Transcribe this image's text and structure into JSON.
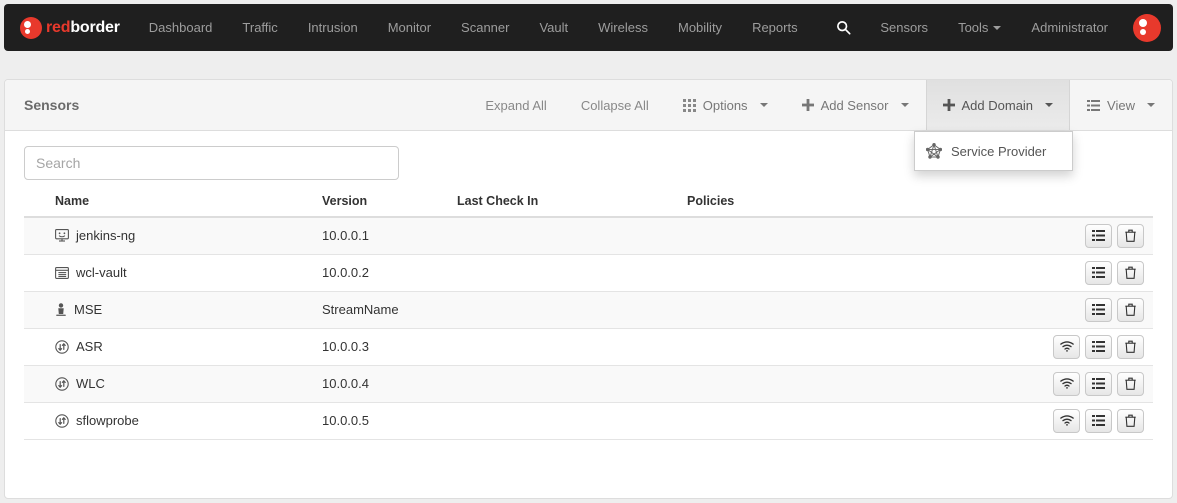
{
  "brand": {
    "part1": "red",
    "part2": "border",
    "logo_icon": "redborder-logo-icon",
    "color": "#e8392c"
  },
  "navbar": {
    "items": [
      {
        "label": "Dashboard"
      },
      {
        "label": "Traffic"
      },
      {
        "label": "Intrusion"
      },
      {
        "label": "Monitor"
      },
      {
        "label": "Scanner"
      },
      {
        "label": "Vault"
      },
      {
        "label": "Wireless"
      },
      {
        "label": "Mobility"
      },
      {
        "label": "Reports"
      }
    ],
    "search_icon": "search-icon",
    "right_items": [
      {
        "label": "Sensors",
        "caret": false
      },
      {
        "label": "Tools",
        "caret": true
      },
      {
        "label": "Administrator",
        "caret": false
      }
    ],
    "avatar_icon": "user-avatar-icon",
    "background": "#1f1f1f"
  },
  "panel": {
    "title": "Sensors",
    "actions": [
      {
        "label": "Expand All",
        "icon": null,
        "caret": false,
        "active": false
      },
      {
        "label": "Collapse All",
        "icon": null,
        "caret": false,
        "active": false
      },
      {
        "label": "Options",
        "icon": "grid-icon",
        "caret": true,
        "active": false
      },
      {
        "label": "Add Sensor",
        "icon": "plus-icon",
        "caret": true,
        "active": false
      },
      {
        "label": "Add Domain",
        "icon": "plus-icon",
        "caret": true,
        "active": true
      },
      {
        "label": "View",
        "icon": "list-icon",
        "caret": true,
        "active": false
      }
    ],
    "dropdown": {
      "open": true,
      "items": [
        {
          "label": "Service Provider",
          "icon": "network-pentagon-icon"
        }
      ]
    }
  },
  "search": {
    "value": "",
    "placeholder": "Search"
  },
  "table": {
    "columns": [
      "Name",
      "Version",
      "Last Check In",
      "Policies"
    ],
    "rows": [
      {
        "icon": "monitor-icon",
        "name": "jenkins-ng",
        "version": "10.0.0.1",
        "last_check_in": "",
        "policies": "",
        "actions": [
          "list-icon",
          "trash-icon"
        ]
      },
      {
        "icon": "server-icon",
        "name": "wcl-vault",
        "version": "10.0.0.2",
        "last_check_in": "",
        "policies": "",
        "actions": [
          "list-icon",
          "trash-icon"
        ]
      },
      {
        "icon": "person-icon",
        "name": "MSE",
        "version": "StreamName",
        "last_check_in": "",
        "policies": "",
        "actions": [
          "list-icon",
          "trash-icon"
        ]
      },
      {
        "icon": "exchange-icon",
        "name": "ASR",
        "version": "10.0.0.3",
        "last_check_in": "",
        "policies": "",
        "actions": [
          "wifi-icon",
          "list-icon",
          "trash-icon"
        ]
      },
      {
        "icon": "exchange-icon",
        "name": "WLC",
        "version": "10.0.0.4",
        "last_check_in": "",
        "policies": "",
        "actions": [
          "wifi-icon",
          "list-icon",
          "trash-icon"
        ]
      },
      {
        "icon": "exchange-icon",
        "name": "sflowprobe",
        "version": "10.0.0.5",
        "last_check_in": "",
        "policies": "",
        "actions": [
          "wifi-icon",
          "list-icon",
          "trash-icon"
        ]
      }
    ]
  }
}
